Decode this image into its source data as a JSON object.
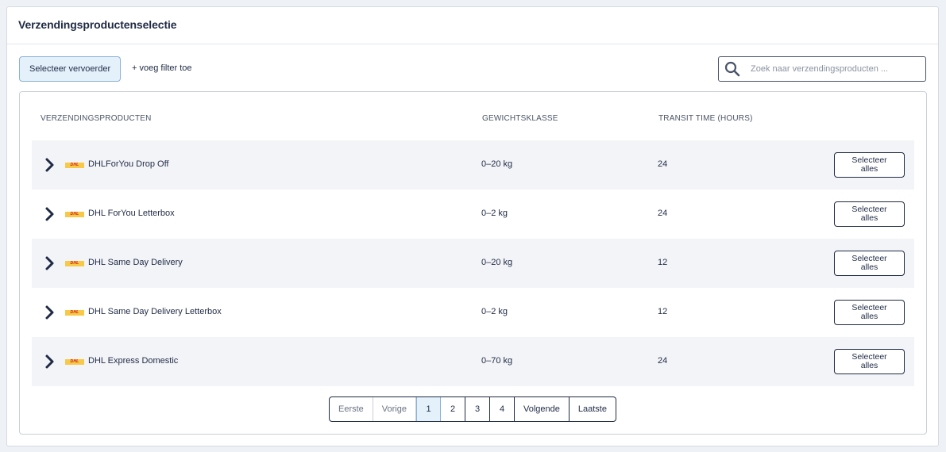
{
  "panel": {
    "title": "Verzendingsproductenselectie"
  },
  "toolbar": {
    "carrier_button": "Selecteer vervoerder",
    "add_filter": "+ voeg filter toe",
    "search_placeholder": "Zoek naar verzendingsproducten ...",
    "search_value": ""
  },
  "table": {
    "headers": [
      "VERZENDINGSPRODUCTEN",
      "GEWICHTSKLASSE",
      "TRANSIT TIME (HOURS)"
    ],
    "rows": [
      {
        "logo_text": "DHL",
        "name": "DHLForYou Drop Off",
        "weight": "0–20 kg",
        "transit": "24",
        "select_label": "Selecteer alles"
      },
      {
        "logo_text": "DHL",
        "name": "DHL ForYou Letterbox",
        "weight": "0–2 kg",
        "transit": "24",
        "select_label": "Selecteer alles"
      },
      {
        "logo_text": "DHL",
        "name": "DHL Same Day Delivery",
        "weight": "0–20 kg",
        "transit": "12",
        "select_label": "Selecteer alles"
      },
      {
        "logo_text": "DHL",
        "name": "DHL Same Day Delivery Letterbox",
        "weight": "0–2 kg",
        "transit": "12",
        "select_label": "Selecteer alles"
      },
      {
        "logo_text": "DHL",
        "name": "DHL Express Domestic",
        "weight": "0–70 kg",
        "transit": "24",
        "select_label": "Selecteer alles"
      }
    ]
  },
  "pagination": {
    "first": "Eerste",
    "prev": "Vorige",
    "pages": [
      "1",
      "2",
      "3",
      "4"
    ],
    "current": "1",
    "next": "Volgende",
    "last": "Laatste"
  },
  "colors": {
    "accent_bg": "#e4f1fb",
    "accent_border": "#8ab2d6",
    "text_dark": "#1f2a44",
    "dhl_yellow": "#f7c948",
    "dhl_red": "#d21a1a"
  },
  "icons": {
    "search": "search-icon",
    "expand": "chevron-right-icon",
    "carrier_logo": "dhl-logo"
  }
}
